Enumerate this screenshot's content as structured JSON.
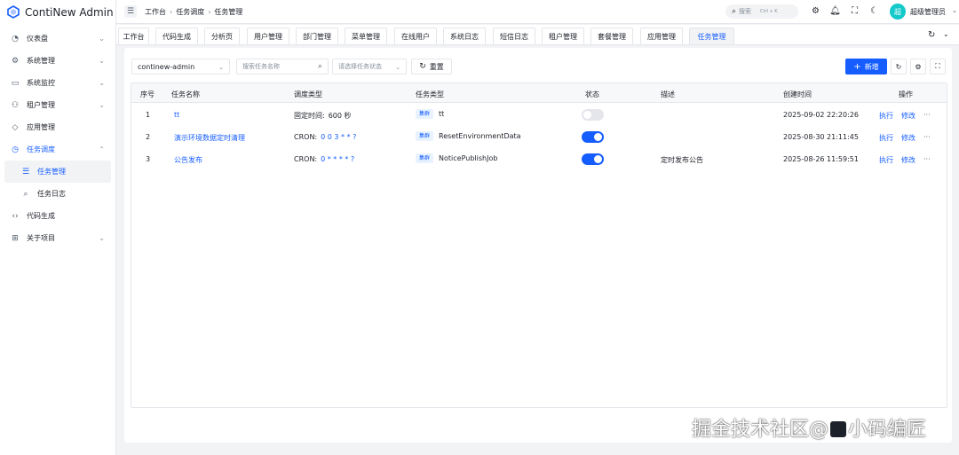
{
  "brand": {
    "name": "ContiNew Admin"
  },
  "sidebar": {
    "items": [
      {
        "label": "仪表盘",
        "icon": "dashboard-icon",
        "arrow": "⌄"
      },
      {
        "label": "系统管理",
        "icon": "settings-icon",
        "arrow": "⌄"
      },
      {
        "label": "系统监控",
        "icon": "monitor-icon",
        "arrow": "⌄"
      },
      {
        "label": "租户管理",
        "icon": "tenant-icon",
        "arrow": "⌄"
      },
      {
        "label": "应用管理",
        "icon": "app-icon",
        "arrow": ""
      },
      {
        "label": "任务调度",
        "icon": "clock-icon",
        "arrow": "⌃"
      },
      {
        "label": "任务管理",
        "icon": "task-list-icon",
        "arrow": ""
      },
      {
        "label": "任务日志",
        "icon": "log-icon",
        "arrow": ""
      },
      {
        "label": "代码生成",
        "icon": "code-icon",
        "arrow": ""
      },
      {
        "label": "关于项目",
        "icon": "grid-icon",
        "arrow": "⌄"
      }
    ]
  },
  "header": {
    "breadcrumb": [
      "工作台",
      "任务调度",
      "任务管理"
    ],
    "search_placeholder": "搜索",
    "search_shortcut": "Ctrl + K",
    "username": "超级管理员",
    "avatar_text": "超"
  },
  "tabs": [
    "工作台",
    "代码生成",
    "分析页",
    "用户管理",
    "部门管理",
    "菜单管理",
    "在线用户",
    "系统日志",
    "短信日志",
    "租户管理",
    "套餐管理",
    "应用管理",
    "任务管理"
  ],
  "toolbar": {
    "group_select": "continew-admin",
    "task_name_placeholder": "搜索任务名称",
    "status_placeholder": "请选择任务状态",
    "reset_label": "重置",
    "add_label": "新增"
  },
  "table": {
    "columns": [
      "序号",
      "任务名称",
      "调度类型",
      "任务类型",
      "状态",
      "描述",
      "创建时间",
      "操作"
    ],
    "rows": [
      {
        "index": "1",
        "name": "tt",
        "schedule_label": "固定时间:",
        "schedule_value": "600 秒",
        "type_tag": "集群",
        "type": "tt",
        "enabled": false,
        "desc": "",
        "created": "2025-09-02 22:20:26",
        "run": "执行",
        "edit": "修改",
        "more": "···"
      },
      {
        "index": "2",
        "name": "演示环境数据定时清理",
        "schedule_label": "CRON:",
        "schedule_value": "0 0 3 * * ?",
        "type_tag": "集群",
        "type": "ResetEnvironmentData",
        "enabled": true,
        "desc": "",
        "created": "2025-08-30 21:11:45",
        "run": "执行",
        "edit": "修改",
        "more": "···"
      },
      {
        "index": "3",
        "name": "公告发布",
        "schedule_label": "CRON:",
        "schedule_value": "0 * * * * ?",
        "type_tag": "集群",
        "type": "NoticePublishJob",
        "enabled": true,
        "desc": "定时发布公告",
        "created": "2025-08-26 11:59:51",
        "run": "执行",
        "edit": "修改",
        "more": "···"
      }
    ]
  },
  "watermark": {
    "text_left": "掘金技术社区",
    "text_at": "@",
    "text_right": "小码编匠"
  },
  "colors": {
    "primary": "#165dff",
    "avatar": "#14c9c9",
    "tag_bg": "#e8f3ff"
  }
}
